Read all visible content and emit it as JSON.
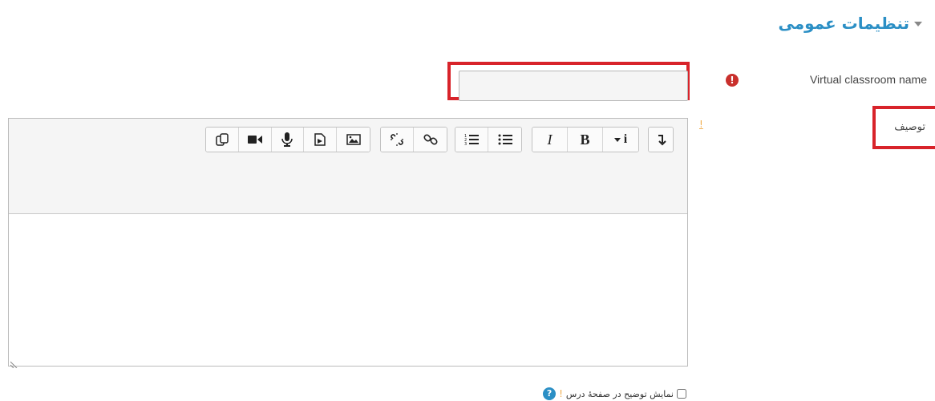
{
  "section": {
    "title": "تنظیمات عمومی",
    "collapse_icon": "chevron-down-icon"
  },
  "name_field": {
    "label": "Virtual classroom name",
    "value": "",
    "placeholder": "",
    "required_icon": "!",
    "highlight_color": "#d8232a"
  },
  "description_field": {
    "label": "توصیف",
    "info_marker": "!",
    "toolbar": [
      {
        "group": "misc",
        "buttons": [
          "show-more-icon"
        ]
      },
      {
        "group": "style",
        "buttons": [
          "bold-icon",
          "italic-icon"
        ]
      },
      {
        "group": "list",
        "buttons": [
          "unordered-list-icon",
          "ordered-list-icon"
        ]
      },
      {
        "group": "links",
        "buttons": [
          "link-icon",
          "unlink-icon"
        ]
      },
      {
        "group": "media",
        "buttons": [
          "image-icon",
          "media-icon",
          "record-audio-icon",
          "record-video-icon",
          "manage-files-icon"
        ]
      }
    ],
    "toolbar_labels": {
      "bold": "B",
      "italic": "I",
      "info": "i"
    }
  },
  "show_description": {
    "label": "نمایش توضیح در صفحهٔ درس",
    "checked": false,
    "help_icon": "?",
    "separator": "!"
  },
  "colors": {
    "accent": "#2b8fc5",
    "required": "#c9302c",
    "info": "#f0ad4e",
    "highlight": "#d8232a"
  }
}
